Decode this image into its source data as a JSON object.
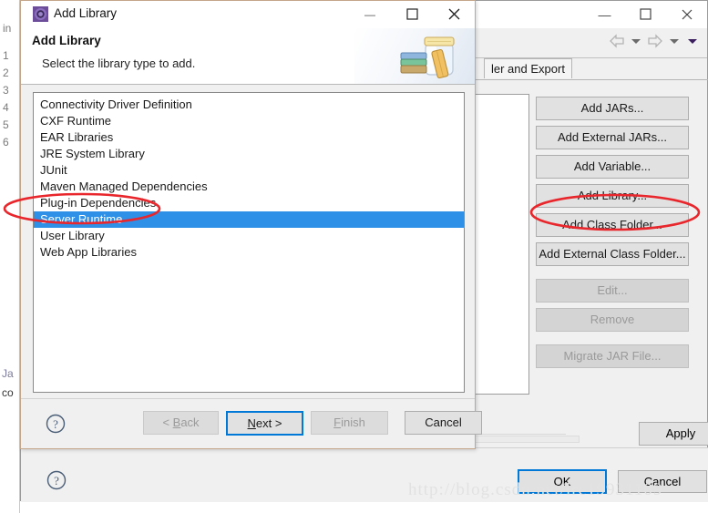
{
  "background_window": {
    "title_controls": {
      "minimize": "—",
      "maximize": "☐",
      "close": "✕"
    },
    "tab_label": "ler and Export",
    "buttons": [
      {
        "label": "Add JARs...",
        "enabled": true
      },
      {
        "label": "Add External JARs...",
        "enabled": true
      },
      {
        "label": "Add Variable...",
        "enabled": true
      },
      {
        "label": "Add Library...",
        "enabled": true
      },
      {
        "label": "Add Class Folder...",
        "enabled": true
      },
      {
        "label": "Add External Class Folder...",
        "enabled": true
      },
      {
        "label": "Edit...",
        "enabled": false
      },
      {
        "label": "Remove",
        "enabled": false
      },
      {
        "label": "Migrate JAR File...",
        "enabled": false
      }
    ],
    "apply_label": "Apply",
    "ok_label": "OK",
    "cancel_label": "Cancel",
    "help_label": "?"
  },
  "editor": {
    "gutter_lines": [
      "in",
      "1",
      "2",
      "3",
      "4",
      "5",
      "6"
    ],
    "code_lines": [
      "Ja",
      "co"
    ]
  },
  "dialog": {
    "window_title": "Add Library",
    "title_controls": {
      "minimize": "—",
      "maximize": "☐",
      "close": "✕"
    },
    "header_title": "Add Library",
    "header_subtitle": "Select the library type to add.",
    "banner_icon": "jar-with-books-image",
    "list": {
      "items": [
        "Connectivity Driver Definition",
        "CXF Runtime",
        "EAR Libraries",
        "JRE System Library",
        "JUnit",
        "Maven Managed Dependencies",
        "Plug-in Dependencies",
        "Server Runtime",
        "User Library",
        "Web App Libraries"
      ],
      "selected_index": 7
    },
    "footer": {
      "help_label": "?",
      "back_label": "< Back",
      "back_enabled": false,
      "next_label": "Next >",
      "next_enabled": true,
      "next_is_default": true,
      "finish_label": "Finish",
      "finish_enabled": false,
      "cancel_label": "Cancel",
      "cancel_enabled": true
    }
  },
  "annotations": {
    "color": "#e8262b",
    "ellipse_targets": [
      "Server Runtime",
      "Add Library..."
    ]
  },
  "watermark": "http://blog.csdn.net/lrc19931109"
}
